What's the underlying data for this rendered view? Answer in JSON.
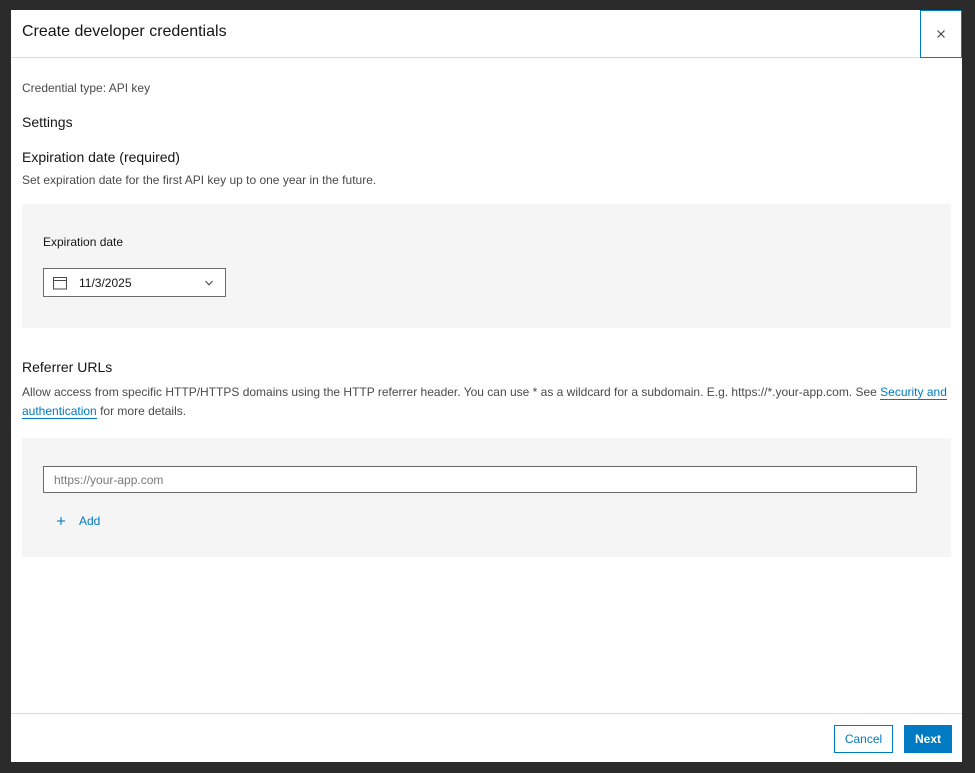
{
  "dialog": {
    "title": "Create developer credentials"
  },
  "credential_type": "Credential type: API key",
  "settings_label": "Settings",
  "expiration": {
    "heading": "Expiration date (required)",
    "description": "Set expiration date for the first API key up to one year in the future.",
    "field_label": "Expiration date",
    "value": "11/3/2025"
  },
  "referrer": {
    "heading": "Referrer URLs",
    "description_before": "Allow access from specific HTTP/HTTPS domains using the HTTP referrer header. You can use * as a wildcard for a subdomain. E.g. https://*.your-app.com. See ",
    "link_text": "Security and authentication",
    "description_after": " for more details.",
    "input_placeholder": "https://your-app.com",
    "add_label": "Add"
  },
  "footer": {
    "cancel_label": "Cancel",
    "next_label": "Next"
  },
  "colors": {
    "accent": "#007ac2",
    "panel_bg": "#f5f5f5"
  }
}
